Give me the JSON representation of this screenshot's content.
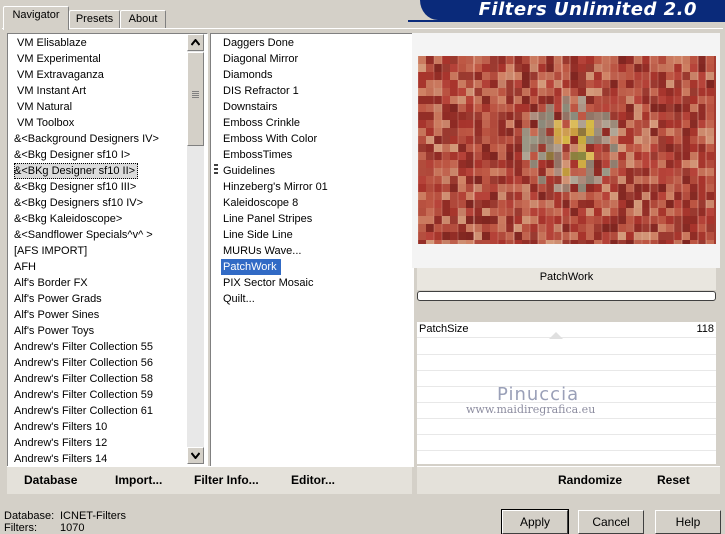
{
  "app": {
    "title": "Filters Unlimited 2.0"
  },
  "tabs": [
    {
      "label": "Navigator",
      "active": true
    },
    {
      "label": "Presets",
      "active": false
    },
    {
      "label": "About",
      "active": false
    }
  ],
  "categories": {
    "items": [
      "VM Elisablaze",
      "VM Experimental",
      "VM Extravaganza",
      "VM Instant Art",
      "VM Natural",
      "VM Toolbox",
      "&<Background Designers IV>",
      "&<Bkg Designer sf10 I>",
      "&<BKg Designer sf10 II>",
      "&<Bkg Designer sf10 III>",
      "&<Bkg Designers sf10 IV>",
      "&<Bkg Kaleidoscope>",
      "&<Sandflower Specials^v^ >",
      "[AFS IMPORT]",
      "AFH",
      "Alf's Border FX",
      "Alf's Power Grads",
      "Alf's Power Sines",
      "Alf's Power Toys",
      "Andrew's Filter Collection 55",
      "Andrew's Filter Collection 56",
      "Andrew's Filter Collection 58",
      "Andrew's Filter Collection 59",
      "Andrew's Filter Collection 61",
      "Andrew's Filters 10",
      "Andrew's Filters 12",
      "Andrew's Filters 14"
    ],
    "selected_index": 8
  },
  "filters": {
    "items": [
      "Daggers Done",
      "Diagonal Mirror",
      "Diamonds",
      "DIS Refractor 1",
      "Downstairs",
      "Emboss Crinkle",
      "Emboss With Color",
      "EmbossTimes",
      "Guidelines",
      "Hinzeberg's Mirror 01",
      "Kaleidoscope 8",
      "Line Panel Stripes",
      "Line Side Line",
      "MURUs Wave...",
      "PatchWork",
      "PIX Sector Mosaic",
      "Quilt..."
    ],
    "selected_index": 14
  },
  "left_toolbar": {
    "database": "Database",
    "import": "Import...",
    "filter_info": "Filter Info...",
    "editor": "Editor..."
  },
  "preview": {
    "filter_name": "PatchWork",
    "params": [
      {
        "label": "PatchSize",
        "value": "118"
      }
    ],
    "watermark_name": "Pinuccia",
    "watermark_url": "www.maidiregrafica.eu"
  },
  "right_toolbar": {
    "randomize": "Randomize",
    "reset": "Reset"
  },
  "status": {
    "database_label": "Database:",
    "database_value": "ICNET-Filters",
    "filters_label": "Filters:",
    "filters_value": "1070"
  },
  "buttons": {
    "apply": "Apply",
    "cancel": "Cancel",
    "help": "Help"
  },
  "colors": {
    "banner": "#0a2a7a",
    "selection": "#316ac5",
    "window": "#d4d0c8"
  },
  "icons": {
    "scroll_up": "chevron-up-icon",
    "scroll_down": "chevron-down-icon"
  }
}
